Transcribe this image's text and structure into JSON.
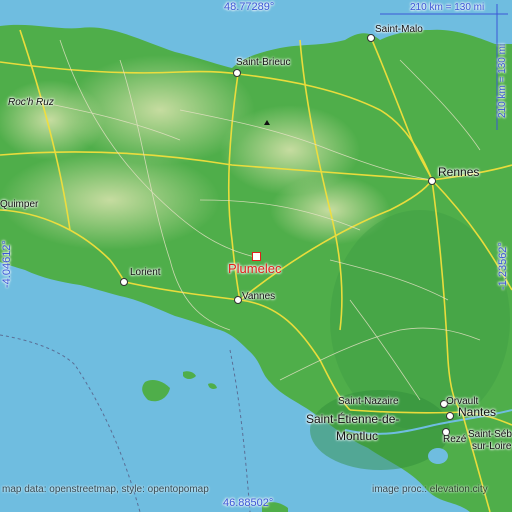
{
  "map": {
    "highlight": {
      "name": "Plumelec",
      "color": "#e0201a"
    },
    "coords": {
      "top": "48.77289°",
      "bottom": "46.88502°",
      "left": "-4.04612°",
      "right": "-1.23562°"
    },
    "scale": {
      "horizontal": "210 km = 130 mi",
      "vertical": "210 km = 130 mi"
    },
    "cities": {
      "saint_malo": "Saint-Malo",
      "saint_brieuc": "Saint-Brieuc",
      "roc_h_ruz": "Roc'h Ruz",
      "rennes": "Rennes",
      "quimper": "Quimper",
      "lorient": "Lorient",
      "vannes": "Vannes",
      "saint_nazaire": "Saint-Nazaire",
      "saint_etienne": "Saint-Étienne-de-",
      "montluc": "Montluc",
      "orvault": "Orvault",
      "nantes": "Nantes",
      "reze": "Rezé",
      "saint_seb": "Saint-Séb",
      "sur_loire": "sur-Loire"
    },
    "footer": {
      "left": "map data: openstreetmap, style: opentopomap",
      "right": "image proc.: elevation.city"
    },
    "colors": {
      "sea": "#6fbde0",
      "lowland": "#4fae4a",
      "upland": "#a9d08a",
      "road": "#f2df3c"
    }
  }
}
